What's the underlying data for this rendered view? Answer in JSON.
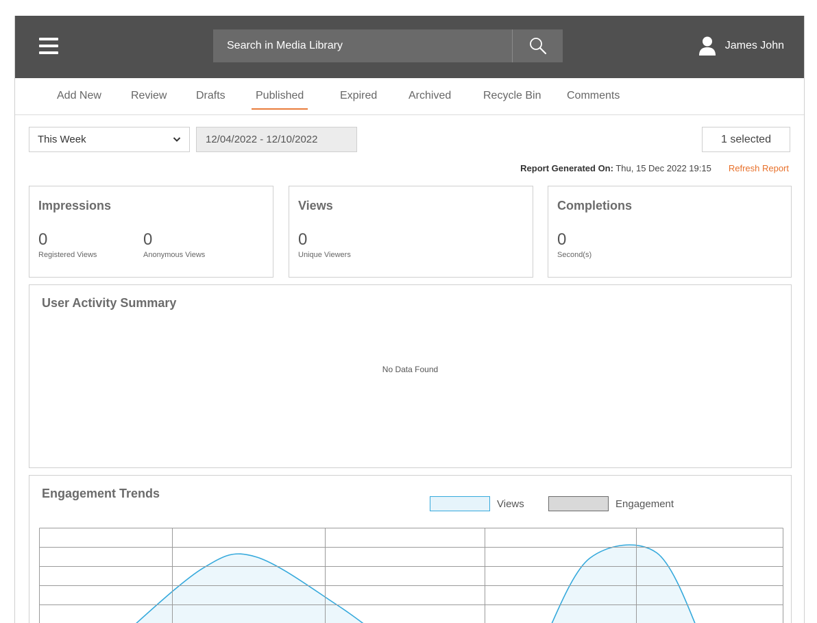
{
  "header": {
    "search_placeholder": "Search in Media Library",
    "user_name": "James John"
  },
  "tabs": [
    {
      "label": "Add New"
    },
    {
      "label": "Review"
    },
    {
      "label": "Drafts"
    },
    {
      "label": "Published",
      "active": true
    },
    {
      "label": "Expired"
    },
    {
      "label": "Archived"
    },
    {
      "label": "Recycle Bin"
    },
    {
      "label": "Comments"
    }
  ],
  "filters": {
    "period": "This Week",
    "date_range": "12/04/2022 - 12/10/2022",
    "selection": "1 selected"
  },
  "report": {
    "label": "Report Generated On:",
    "timestamp": "Thu, 15 Dec 2022 19:15",
    "refresh_label": "Refresh Report"
  },
  "cards": {
    "impressions": {
      "title": "Impressions",
      "registered": {
        "value": "0",
        "label": "Registered Views"
      },
      "anonymous": {
        "value": "0",
        "label": "Anonymous Views"
      }
    },
    "views": {
      "title": "Views",
      "unique": {
        "value": "0",
        "label": "Unique Viewers"
      }
    },
    "completions": {
      "title": "Completions",
      "seconds": {
        "value": "0",
        "label": "Second(s)"
      }
    }
  },
  "activity": {
    "title": "User Activity Summary",
    "empty_message": "No Data Found"
  },
  "engagement": {
    "title": "Engagement Trends",
    "legend": {
      "views": "Views",
      "engagement": "Engagement"
    }
  },
  "colors": {
    "topbar": "#505050",
    "accent": "#e8702a",
    "views_line": "#35a9dc",
    "views_fill": "#e6f4fb"
  },
  "chart_data": {
    "type": "area",
    "series": [
      {
        "name": "Views",
        "x": [
          0.11,
          0.22,
          0.29,
          0.4,
          0.47
        ],
        "y": [
          0.12,
          1.37,
          1.58,
          0.7,
          0.0
        ]
      },
      {
        "name": "Views",
        "x": [
          0.68,
          0.74,
          0.83,
          0.89
        ],
        "y": [
          0.1,
          1.55,
          1.65,
          0.1
        ]
      }
    ]
  }
}
